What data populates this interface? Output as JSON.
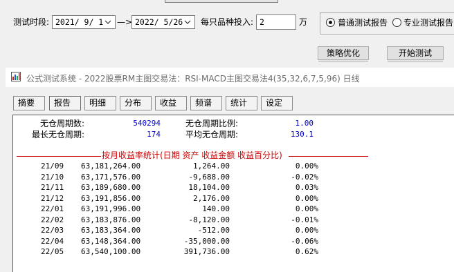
{
  "params": {
    "period_label": "测试时段:",
    "start_date": "2021/ 9/ 1",
    "arrow": "—>",
    "end_date": "2022/ 5/26",
    "invest_label": "每只品种投入:",
    "invest_value": "2",
    "invest_unit": "万",
    "mode_normal_label": "普通测试报告",
    "mode_pro_label": "专业测试报告",
    "mode_selected": "normal",
    "optimize_label": "策略优化",
    "start_label": "开始测试"
  },
  "window": {
    "title": "公式测试系统 - 2022股票RM主图交易法：RSI-MACD主图交易法4(35,32,6,7,5,96) 日线"
  },
  "tabs": [
    {
      "label": "摘要",
      "active": false
    },
    {
      "label": "报告",
      "active": true
    },
    {
      "label": "明细",
      "active": false
    },
    {
      "label": "分布",
      "active": false
    },
    {
      "label": "收益",
      "active": false
    },
    {
      "label": "频谱",
      "active": false
    },
    {
      "label": "统计",
      "active": false
    },
    {
      "label": "设定",
      "active": false
    }
  ],
  "stats": {
    "no_pos_periods_label": "无仓周期数:",
    "no_pos_periods_value": "540294",
    "no_pos_ratio_label": "无仓周期比例:",
    "no_pos_ratio_value": "1.00",
    "max_no_pos_label": "最长无仓周期:",
    "max_no_pos_value": "174",
    "avg_no_pos_label": "平均无仓周期:",
    "avg_no_pos_value": "130.1"
  },
  "monthly": {
    "header": "按月收益率统计(日期 资产 收益金额 收益百分比)",
    "rows": [
      {
        "date": "21/09",
        "assets": "63,181,264.00",
        "amount": "1,264.00",
        "pct": "0.00%"
      },
      {
        "date": "21/10",
        "assets": "63,171,576.00",
        "amount": "-9,688.00",
        "pct": "-0.02%"
      },
      {
        "date": "21/11",
        "assets": "63,189,680.00",
        "amount": "18,104.00",
        "pct": "0.03%"
      },
      {
        "date": "21/12",
        "assets": "63,191,856.00",
        "amount": "2,176.00",
        "pct": "0.00%"
      },
      {
        "date": "22/01",
        "assets": "63,191,996.00",
        "amount": "140.00",
        "pct": "0.00%"
      },
      {
        "date": "22/02",
        "assets": "63,183,876.00",
        "amount": "-8,120.00",
        "pct": "-0.01%"
      },
      {
        "date": "22/03",
        "assets": "63,183,364.00",
        "amount": "-512.00",
        "pct": "0.00%"
      },
      {
        "date": "22/04",
        "assets": "63,148,364.00",
        "amount": "-35,000.00",
        "pct": "-0.06%"
      },
      {
        "date": "22/05",
        "assets": "63,540,100.00",
        "amount": "391,736.00",
        "pct": "0.62%"
      }
    ]
  },
  "colors": {
    "accent_red": "#cc0000",
    "value_blue": "#0000cc"
  }
}
